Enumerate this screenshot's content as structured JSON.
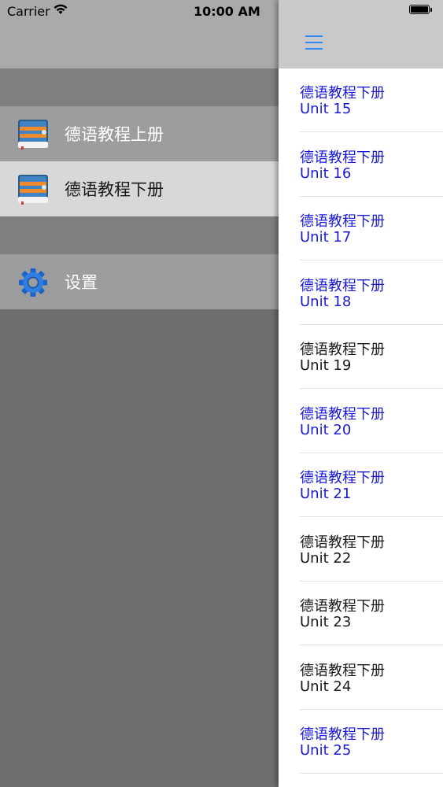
{
  "status_bar": {
    "carrier": "Carrier",
    "time": "10:00 AM"
  },
  "menu": {
    "items": [
      {
        "label": "德语教程上册",
        "icon": "book-icon"
      },
      {
        "label": "德语教程下册",
        "icon": "book-icon",
        "selected": true
      },
      {
        "label": "设置",
        "icon": "gear-icon"
      }
    ]
  },
  "colors": {
    "link": "#1a1ad6",
    "visited": "#1a1a1a",
    "accent": "#2d8cf0",
    "selected_row": "#d8d8d9"
  },
  "list": {
    "rows": [
      {
        "title": "德语教程下册",
        "unit": "Unit 15",
        "state": "link"
      },
      {
        "title": "德语教程下册",
        "unit": "Unit 16",
        "state": "link"
      },
      {
        "title": "德语教程下册",
        "unit": "Unit 17",
        "state": "link"
      },
      {
        "title": "德语教程下册",
        "unit": "Unit 18",
        "state": "link"
      },
      {
        "title": "德语教程下册",
        "unit": "Unit 19",
        "state": "visited"
      },
      {
        "title": "德语教程下册",
        "unit": "Unit 20",
        "state": "link"
      },
      {
        "title": "德语教程下册",
        "unit": "Unit 21",
        "state": "link"
      },
      {
        "title": "德语教程下册",
        "unit": "Unit 22",
        "state": "visited"
      },
      {
        "title": "德语教程下册",
        "unit": "Unit 23",
        "state": "visited"
      },
      {
        "title": "德语教程下册",
        "unit": "Unit 24",
        "state": "visited"
      },
      {
        "title": "德语教程下册",
        "unit": "Unit 25",
        "state": "link"
      }
    ]
  }
}
